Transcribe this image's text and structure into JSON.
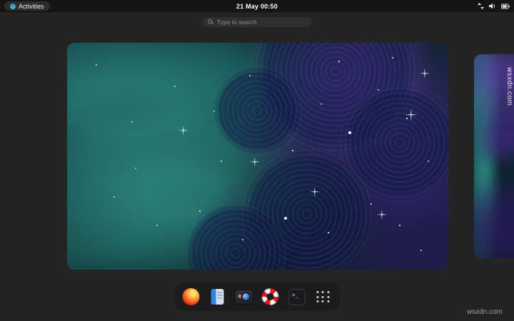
{
  "topbar": {
    "activities": {
      "label": "Activities",
      "logo_icon": "distro-logo-icon"
    },
    "clock": "21 May 00:50",
    "status": {
      "icons": [
        "network-icon",
        "volume-icon",
        "battery-icon"
      ]
    }
  },
  "search": {
    "placeholder": "Type to search"
  },
  "overview": {
    "workspaces": [
      {
        "id": "workspace-1",
        "active": true
      },
      {
        "id": "workspace-2",
        "active": false
      }
    ]
  },
  "dock": {
    "apps": [
      {
        "id": "firefox",
        "icon": "firefox-icon"
      },
      {
        "id": "files",
        "icon": "files-icon"
      },
      {
        "id": "camera",
        "icon": "camera-icon"
      },
      {
        "id": "help",
        "icon": "help-icon"
      },
      {
        "id": "terminal",
        "icon": "terminal-icon"
      }
    ],
    "terminal_glyph": ">_",
    "show_apps_icon": "app-grid-icon"
  },
  "watermark": {
    "text": "wsxdn.com"
  },
  "colors": {
    "background": "#242424",
    "topbar_bg": "#141414",
    "dock_bg": "#1c1c1c",
    "accent": "#3584e4",
    "help_red": "#e01b24",
    "firefox_orange": "#ff7139",
    "wallpaper_teal": "#2a9d8f",
    "wallpaper_purple": "#5e35b1"
  }
}
